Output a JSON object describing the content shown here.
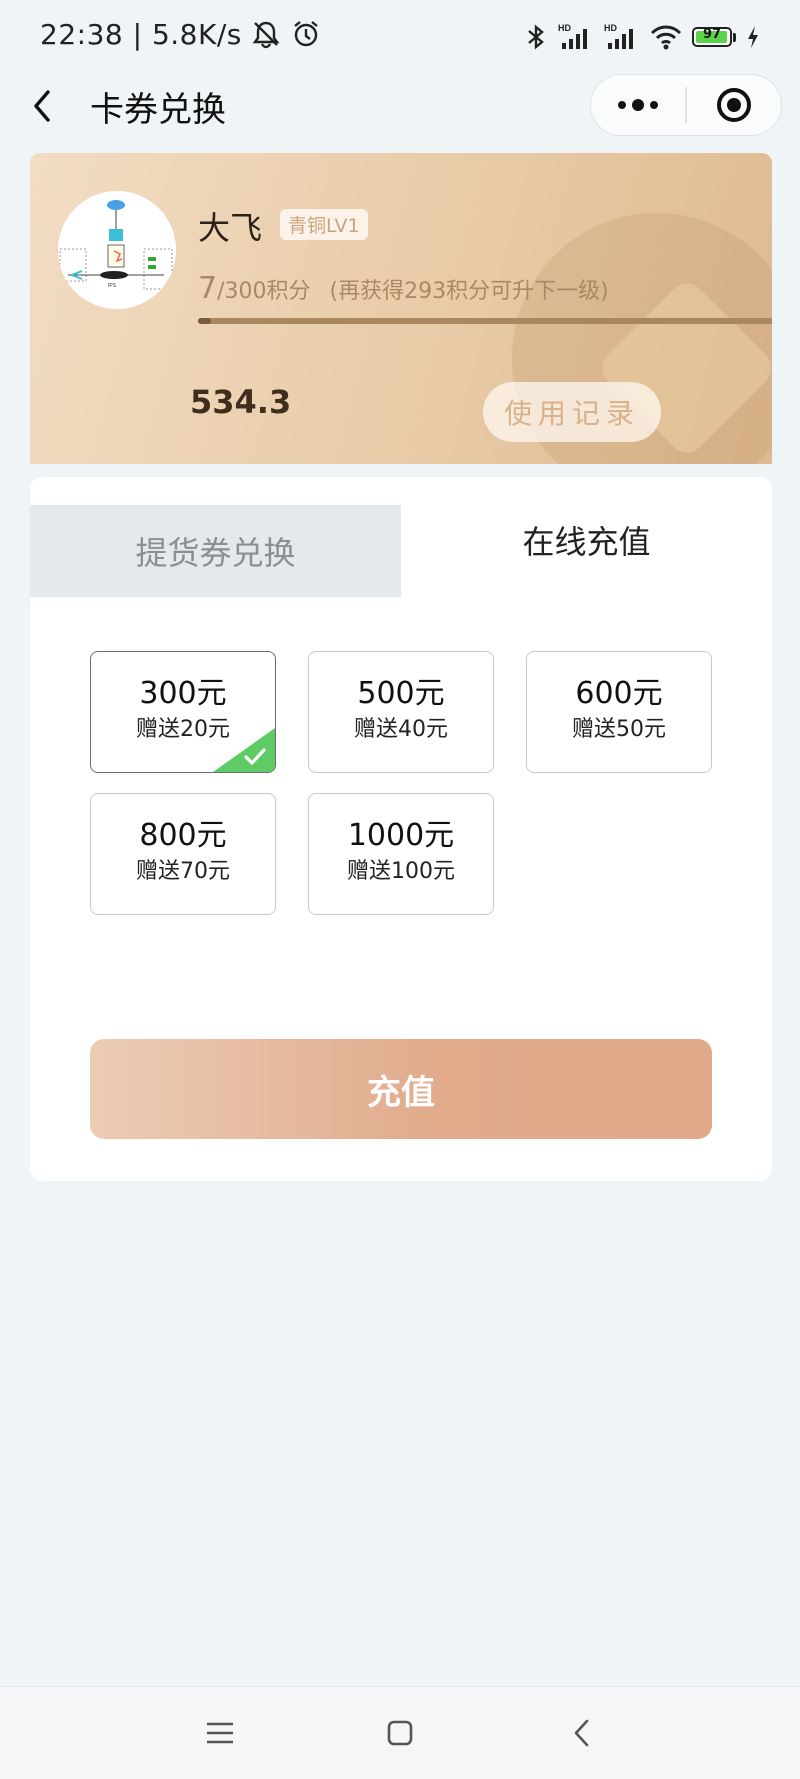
{
  "status_bar": {
    "time": "22:38",
    "separator": "|",
    "speed": "5.8K/s",
    "battery": "97",
    "icons": [
      "mute-icon",
      "alarm-icon",
      "bluetooth-icon",
      "hd-signal-icon",
      "hd-signal-icon",
      "wifi-icon",
      "battery-icon",
      "charging-icon"
    ]
  },
  "header": {
    "title": "卡券兑换",
    "back_icon": "back-arrow-icon",
    "menu_icon": "more-dots-icon",
    "close_icon": "target-circle-icon"
  },
  "member_card": {
    "user_name": "大飞",
    "level": "青铜LV1",
    "points_current": "7",
    "points_rest": "/300积分",
    "points_hint": "(再获得293积分可升下一级)",
    "progress_fraction": 0.023,
    "balance": "534.3",
    "record_button": "使用记录"
  },
  "tabs": [
    {
      "label": "提货券兑换",
      "active": false
    },
    {
      "label": "在线充值",
      "active": true
    }
  ],
  "amounts": [
    {
      "amount": "300元",
      "bonus": "赠送20元",
      "selected": true
    },
    {
      "amount": "500元",
      "bonus": "赠送40元",
      "selected": false
    },
    {
      "amount": "600元",
      "bonus": "赠送50元",
      "selected": false
    },
    {
      "amount": "800元",
      "bonus": "赠送70元",
      "selected": false
    },
    {
      "amount": "1000元",
      "bonus": "赠送100元",
      "selected": false
    }
  ],
  "recharge_button": "充值",
  "colors": {
    "card_gradient_start": "#f2dcc3",
    "card_gradient_end": "#dfb98f",
    "selected_check": "#5ecb64",
    "button_gradient_start": "#ebccb6",
    "button_gradient_end": "#dfa98a",
    "page_background": "#eff4f7"
  },
  "navbar": {
    "icons": [
      "menu-lines-icon",
      "home-square-icon",
      "back-chevron-icon"
    ]
  }
}
